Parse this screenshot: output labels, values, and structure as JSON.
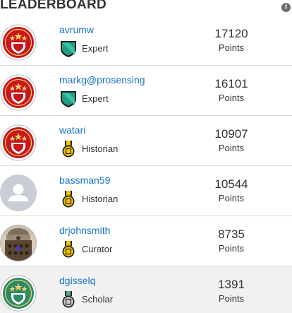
{
  "leaderboard": {
    "title": "LEADERBOARD",
    "info_icon": "info-icon",
    "points_label": "Points",
    "rows": [
      {
        "username": "avrumw",
        "rank": "Expert",
        "score": "17120",
        "avatar": "red-star-badge",
        "rank_icon": "green-shield-icon"
      },
      {
        "username": "markg@prosensing",
        "rank": "Expert",
        "score": "16101",
        "avatar": "red-star-badge",
        "rank_icon": "green-shield-icon"
      },
      {
        "username": "watari",
        "rank": "Historian",
        "score": "10907",
        "avatar": "red-star-badge",
        "rank_icon": "gold-medal-icon"
      },
      {
        "username": "bassman59",
        "rank": "Historian",
        "score": "10544",
        "avatar": "default-user-avatar",
        "rank_icon": "gold-medal-icon"
      },
      {
        "username": "drjohnsmith",
        "rank": "Curator",
        "score": "8735",
        "avatar": "photo-avatar",
        "rank_icon": "gold-medal-icon"
      },
      {
        "username": "dgisselq",
        "rank": "Scholar",
        "score": "1391",
        "avatar": "green-star-badge",
        "rank_icon": "silver-medal-icon"
      }
    ]
  }
}
